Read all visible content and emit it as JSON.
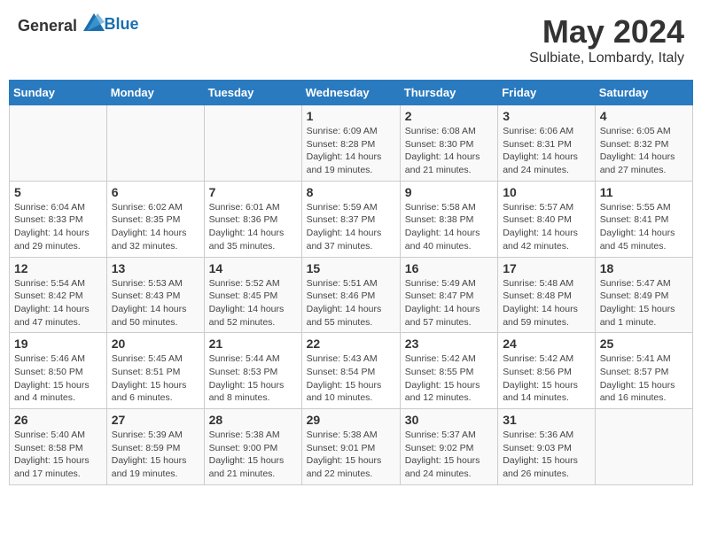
{
  "header": {
    "logo_general": "General",
    "logo_blue": "Blue",
    "month_title": "May 2024",
    "location": "Sulbiate, Lombardy, Italy"
  },
  "days_of_week": [
    "Sunday",
    "Monday",
    "Tuesday",
    "Wednesday",
    "Thursday",
    "Friday",
    "Saturday"
  ],
  "weeks": [
    [
      {
        "day": "",
        "info": ""
      },
      {
        "day": "",
        "info": ""
      },
      {
        "day": "",
        "info": ""
      },
      {
        "day": "1",
        "info": "Sunrise: 6:09 AM\nSunset: 8:28 PM\nDaylight: 14 hours and 19 minutes."
      },
      {
        "day": "2",
        "info": "Sunrise: 6:08 AM\nSunset: 8:30 PM\nDaylight: 14 hours and 21 minutes."
      },
      {
        "day": "3",
        "info": "Sunrise: 6:06 AM\nSunset: 8:31 PM\nDaylight: 14 hours and 24 minutes."
      },
      {
        "day": "4",
        "info": "Sunrise: 6:05 AM\nSunset: 8:32 PM\nDaylight: 14 hours and 27 minutes."
      }
    ],
    [
      {
        "day": "5",
        "info": "Sunrise: 6:04 AM\nSunset: 8:33 PM\nDaylight: 14 hours and 29 minutes."
      },
      {
        "day": "6",
        "info": "Sunrise: 6:02 AM\nSunset: 8:35 PM\nDaylight: 14 hours and 32 minutes."
      },
      {
        "day": "7",
        "info": "Sunrise: 6:01 AM\nSunset: 8:36 PM\nDaylight: 14 hours and 35 minutes."
      },
      {
        "day": "8",
        "info": "Sunrise: 5:59 AM\nSunset: 8:37 PM\nDaylight: 14 hours and 37 minutes."
      },
      {
        "day": "9",
        "info": "Sunrise: 5:58 AM\nSunset: 8:38 PM\nDaylight: 14 hours and 40 minutes."
      },
      {
        "day": "10",
        "info": "Sunrise: 5:57 AM\nSunset: 8:40 PM\nDaylight: 14 hours and 42 minutes."
      },
      {
        "day": "11",
        "info": "Sunrise: 5:55 AM\nSunset: 8:41 PM\nDaylight: 14 hours and 45 minutes."
      }
    ],
    [
      {
        "day": "12",
        "info": "Sunrise: 5:54 AM\nSunset: 8:42 PM\nDaylight: 14 hours and 47 minutes."
      },
      {
        "day": "13",
        "info": "Sunrise: 5:53 AM\nSunset: 8:43 PM\nDaylight: 14 hours and 50 minutes."
      },
      {
        "day": "14",
        "info": "Sunrise: 5:52 AM\nSunset: 8:45 PM\nDaylight: 14 hours and 52 minutes."
      },
      {
        "day": "15",
        "info": "Sunrise: 5:51 AM\nSunset: 8:46 PM\nDaylight: 14 hours and 55 minutes."
      },
      {
        "day": "16",
        "info": "Sunrise: 5:49 AM\nSunset: 8:47 PM\nDaylight: 14 hours and 57 minutes."
      },
      {
        "day": "17",
        "info": "Sunrise: 5:48 AM\nSunset: 8:48 PM\nDaylight: 14 hours and 59 minutes."
      },
      {
        "day": "18",
        "info": "Sunrise: 5:47 AM\nSunset: 8:49 PM\nDaylight: 15 hours and 1 minute."
      }
    ],
    [
      {
        "day": "19",
        "info": "Sunrise: 5:46 AM\nSunset: 8:50 PM\nDaylight: 15 hours and 4 minutes."
      },
      {
        "day": "20",
        "info": "Sunrise: 5:45 AM\nSunset: 8:51 PM\nDaylight: 15 hours and 6 minutes."
      },
      {
        "day": "21",
        "info": "Sunrise: 5:44 AM\nSunset: 8:53 PM\nDaylight: 15 hours and 8 minutes."
      },
      {
        "day": "22",
        "info": "Sunrise: 5:43 AM\nSunset: 8:54 PM\nDaylight: 15 hours and 10 minutes."
      },
      {
        "day": "23",
        "info": "Sunrise: 5:42 AM\nSunset: 8:55 PM\nDaylight: 15 hours and 12 minutes."
      },
      {
        "day": "24",
        "info": "Sunrise: 5:42 AM\nSunset: 8:56 PM\nDaylight: 15 hours and 14 minutes."
      },
      {
        "day": "25",
        "info": "Sunrise: 5:41 AM\nSunset: 8:57 PM\nDaylight: 15 hours and 16 minutes."
      }
    ],
    [
      {
        "day": "26",
        "info": "Sunrise: 5:40 AM\nSunset: 8:58 PM\nDaylight: 15 hours and 17 minutes."
      },
      {
        "day": "27",
        "info": "Sunrise: 5:39 AM\nSunset: 8:59 PM\nDaylight: 15 hours and 19 minutes."
      },
      {
        "day": "28",
        "info": "Sunrise: 5:38 AM\nSunset: 9:00 PM\nDaylight: 15 hours and 21 minutes."
      },
      {
        "day": "29",
        "info": "Sunrise: 5:38 AM\nSunset: 9:01 PM\nDaylight: 15 hours and 22 minutes."
      },
      {
        "day": "30",
        "info": "Sunrise: 5:37 AM\nSunset: 9:02 PM\nDaylight: 15 hours and 24 minutes."
      },
      {
        "day": "31",
        "info": "Sunrise: 5:36 AM\nSunset: 9:03 PM\nDaylight: 15 hours and 26 minutes."
      },
      {
        "day": "",
        "info": ""
      }
    ]
  ]
}
